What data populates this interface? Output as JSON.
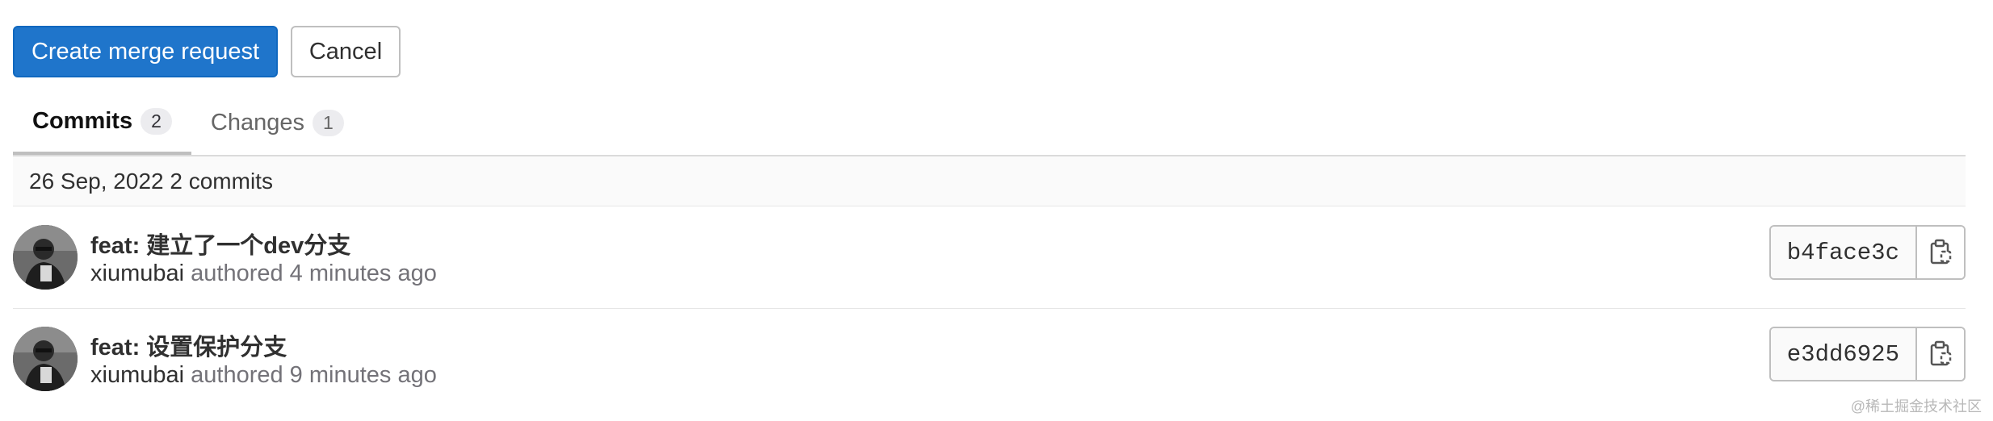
{
  "actions": {
    "create_label": "Create merge request",
    "cancel_label": "Cancel"
  },
  "tabs": [
    {
      "label": "Commits",
      "count": "2",
      "active": true
    },
    {
      "label": "Changes",
      "count": "1",
      "active": false
    }
  ],
  "commit_list": {
    "day_header": "26 Sep, 2022 2 commits",
    "commits": [
      {
        "title": "feat: 建立了一个dev分支",
        "author": "xiumubai",
        "authored_text": "authored 4 minutes ago",
        "sha": "b4face3c",
        "avatar_icon": "user-avatar",
        "copy_icon": "clipboard-copy-icon"
      },
      {
        "title": "feat: 设置保护分支",
        "author": "xiumubai",
        "authored_text": "authored 9 minutes ago",
        "sha": "e3dd6925",
        "avatar_icon": "user-avatar",
        "copy_icon": "clipboard-copy-icon"
      }
    ]
  },
  "watermark": "@稀土掘金技术社区",
  "colors": {
    "primary": "#1f75cb",
    "border": "#bfbfbf",
    "muted_text": "#737278"
  }
}
